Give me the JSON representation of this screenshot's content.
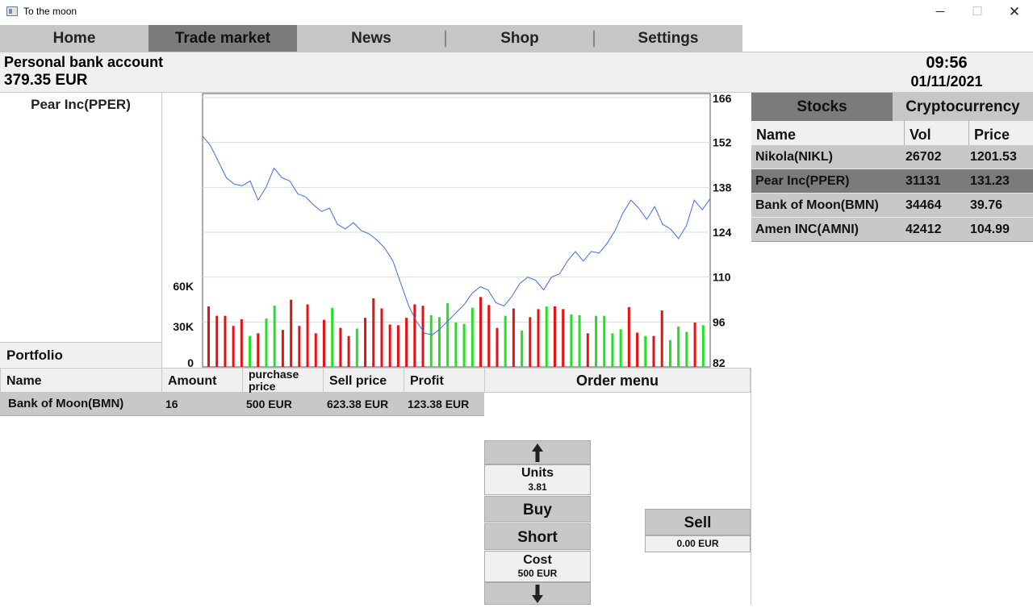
{
  "window": {
    "title": "To the moon",
    "minimize": "─",
    "maximize": "☐",
    "close": "✕"
  },
  "nav": {
    "tabs": [
      "Home",
      "Trade market",
      "News",
      "Shop",
      "Settings"
    ],
    "active": "Trade market"
  },
  "header": {
    "account_label": "Personal bank account",
    "balance": "379.35 EUR",
    "time": "09:56",
    "date": "01/11/2021"
  },
  "stock": {
    "name": "Pear Inc(PPER)"
  },
  "portfolio": {
    "label": "Portfolio",
    "columns": [
      "Name",
      "Amount",
      "purchase price",
      "Sell price",
      "Profit"
    ],
    "rows": [
      [
        "Bank of Moon(BMN)",
        "16",
        "500 EUR",
        "623.38 EUR",
        "123.38 EUR"
      ]
    ]
  },
  "order": {
    "title": "Order menu",
    "units_label": "Units",
    "units_value": "3.81",
    "buy_label": "Buy",
    "short_label": "Short",
    "cost_label": "Cost",
    "cost_value": "500 EUR",
    "sell_label": "Sell",
    "sell_value": "0.00 EUR"
  },
  "market": {
    "tabs": [
      "Stocks",
      "Cryptocurrency"
    ],
    "active_tab": "Stocks",
    "columns": [
      "Name",
      "Vol",
      "Price"
    ],
    "rows": [
      [
        "Nikola(NIKL)",
        "26702",
        "1201.53"
      ],
      [
        "Pear Inc(PPER)",
        "31131",
        "131.23"
      ],
      [
        "Bank of Moon(BMN)",
        "34464",
        "39.76"
      ],
      [
        "Amen INC(AMNI)",
        "42412",
        "104.99"
      ]
    ],
    "selected": "Pear Inc(PPER)"
  },
  "colors": {
    "price_line": "#3f6fe0",
    "volume_up": "#22e022",
    "volume_down": "#e81010",
    "active_tab": "#7b7b7b",
    "tab": "#c6c6c6"
  },
  "chart_data": {
    "type": "line",
    "price_ticks": [
      166,
      152,
      138,
      124,
      110,
      96,
      82
    ],
    "price_ylim": [
      82,
      166
    ],
    "volume_ticks": [
      "60K",
      "30K",
      "0"
    ],
    "volume_ylim": [
      0,
      90000
    ],
    "price": [
      154,
      151,
      146,
      141,
      139,
      138.5,
      140,
      134,
      138,
      144,
      141,
      140,
      136,
      135,
      132.5,
      130.5,
      131.5,
      126.5,
      125,
      127,
      124.5,
      123.5,
      121.5,
      119,
      115,
      108,
      101,
      96,
      92.5,
      92,
      94,
      96.5,
      99,
      101.5,
      105,
      107,
      106,
      102,
      101,
      104,
      108,
      110,
      109,
      106,
      110,
      111,
      115,
      118,
      115,
      118,
      117.5,
      120.5,
      124.5,
      130,
      134,
      131.5,
      128,
      132,
      126.5,
      125,
      122,
      126,
      134,
      131,
      134.5
    ],
    "volume": [
      45000,
      38000,
      38000,
      30500,
      35500,
      23000,
      25000,
      36000,
      45500,
      27500,
      50000,
      30500,
      46500,
      25000,
      35000,
      44000,
      29000,
      23000,
      28500,
      36500,
      51000,
      43500,
      31500,
      31000,
      36500,
      46500,
      45500,
      38500,
      37000,
      47500,
      33000,
      32000,
      44000,
      52000,
      46000,
      29000,
      38000,
      43500,
      27000,
      37000,
      43000,
      44900,
      45100,
      43000,
      39000,
      38500,
      25000,
      38000,
      38000,
      25000,
      28000,
      44500,
      25500,
      23000,
      23000,
      42000,
      20000,
      30000,
      26000,
      33000,
      31000
    ],
    "volume_up": [
      false,
      false,
      false,
      false,
      false,
      true,
      false,
      true,
      true,
      false,
      false,
      false,
      false,
      false,
      false,
      true,
      false,
      false,
      true,
      false,
      false,
      false,
      false,
      false,
      false,
      false,
      false,
      true,
      true,
      true,
      true,
      true,
      true,
      false,
      false,
      false,
      true,
      false,
      true,
      false,
      false,
      true,
      false,
      false,
      true,
      true,
      false,
      true,
      true,
      true,
      true,
      false,
      false,
      true,
      false,
      false,
      true,
      true,
      true,
      false,
      true
    ]
  }
}
